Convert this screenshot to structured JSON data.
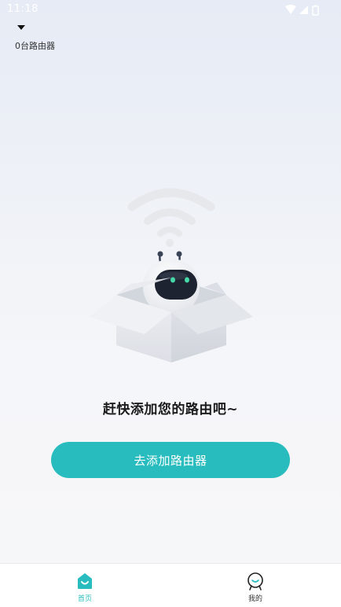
{
  "status_bar": {
    "time": "11:18",
    "icons": [
      "wifi-icon",
      "cellular-signal-icon",
      "battery-icon"
    ]
  },
  "header": {
    "dropdown_icon": "caret-down-icon",
    "router_count": "0台路由器"
  },
  "empty_state": {
    "illustration": "robot-in-box-with-wifi-illustration",
    "message": "赶快添加您的路由吧~",
    "button_label": "去添加路由器"
  },
  "tab_bar": {
    "tabs": [
      {
        "label": "首页",
        "icon": "home-icon",
        "active": true
      },
      {
        "label": "我的",
        "icon": "profile-icon",
        "active": false
      }
    ]
  },
  "colors": {
    "accent": "#28bcbe",
    "text_primary": "#1a1a1a",
    "background": "#f7f7f9"
  }
}
